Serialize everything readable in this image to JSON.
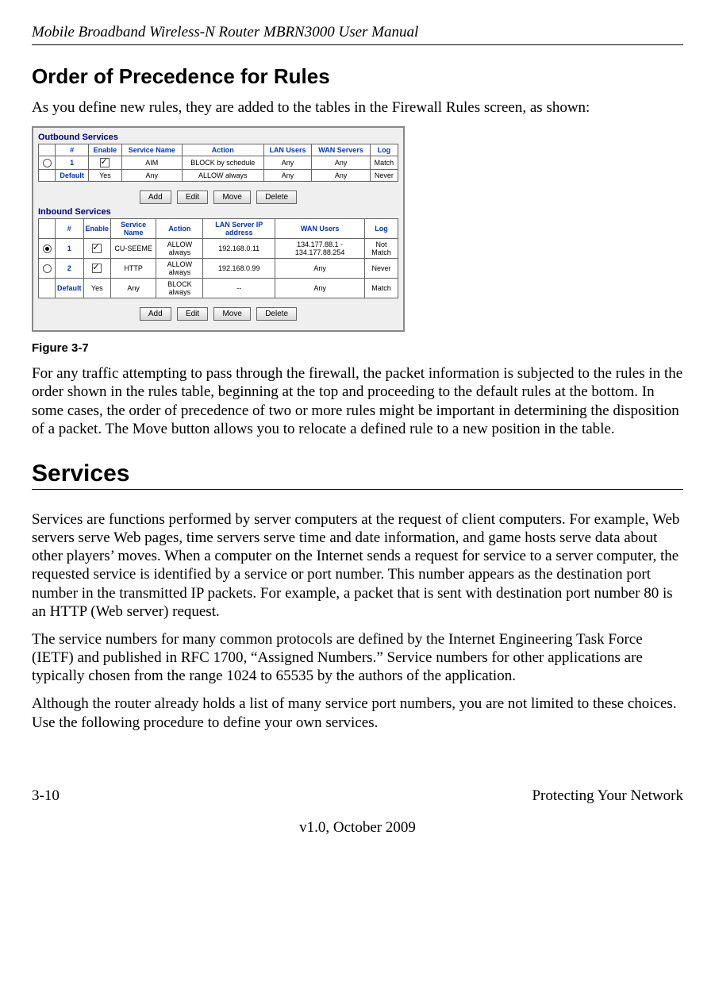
{
  "header": {
    "title": "Mobile Broadband Wireless-N Router MBRN3000 User Manual"
  },
  "subheading1": "Order of Precedence for Rules",
  "p1": "As you define new rules, they are added to the tables in the Firewall Rules screen, as shown:",
  "figure": {
    "outbound_label": "Outbound Services",
    "inbound_label": "Inbound Services",
    "out_headers": {
      "num": "#",
      "enable": "Enable",
      "service": "Service Name",
      "action": "Action",
      "lan": "LAN Users",
      "wan": "WAN Servers",
      "log": "Log"
    },
    "out_rows": [
      {
        "sel": false,
        "num": "1",
        "enable": true,
        "service": "AIM",
        "action": "BLOCK by schedule",
        "lan": "Any",
        "wan": "Any",
        "log": "Match"
      },
      {
        "num": "Default",
        "enable_txt": "Yes",
        "service": "Any",
        "action": "ALLOW always",
        "lan": "Any",
        "wan": "Any",
        "log": "Never"
      }
    ],
    "in_headers": {
      "num": "#",
      "enable": "Enable",
      "service": "Service Name",
      "action": "Action",
      "lanip": "LAN Server IP address",
      "wan": "WAN Users",
      "log": "Log"
    },
    "in_rows": [
      {
        "sel": true,
        "num": "1",
        "enable": true,
        "service": "CU-SEEME",
        "action": "ALLOW always",
        "lanip": "192.168.0.11",
        "wan": "134.177.88.1 - 134.177.88.254",
        "log": "Not Match"
      },
      {
        "sel": false,
        "num": "2",
        "enable": true,
        "service": "HTTP",
        "action": "ALLOW always",
        "lanip": "192.168.0.99",
        "wan": "Any",
        "log": "Never"
      },
      {
        "num": "Default",
        "enable_txt": "Yes",
        "service": "Any",
        "action": "BLOCK always",
        "lanip": "--",
        "wan": "Any",
        "log": "Match"
      }
    ],
    "buttons": {
      "add": "Add",
      "edit": "Edit",
      "move": "Move",
      "delete": "Delete"
    },
    "caption": "Figure 3-7"
  },
  "p2": "For any traffic attempting to pass through the firewall, the packet information is subjected to the rules in the order shown in the rules table, beginning at the top and proceeding to the default rules at the bottom. In some cases, the order of precedence of two or more rules might be important in determining the disposition of a packet. The Move button allows you to relocate a defined rule to a new position in the table.",
  "section2": "Services",
  "p3": "Services are functions performed by server computers at the request of client computers. For example, Web servers serve Web pages, time servers serve time and date information, and game hosts serve data about other players’ moves. When a computer on the Internet sends a request for service to a server computer, the requested service is identified by a service or port number. This number appears as the destination port number in the transmitted IP packets. For example, a packet that is sent with destination port number 80 is an HTTP (Web server) request.",
  "p4": "The service numbers for many common protocols are defined by the Internet Engineering Task Force (IETF) and published in RFC 1700, “Assigned Numbers.” Service numbers for other applications are typically chosen from the range 1024 to 65535 by the authors of the application.",
  "p5": "Although the router already holds a list of many service port numbers, you are not limited to these choices. Use the following procedure to define your own services.",
  "footer": {
    "left": "3-10",
    "right": "Protecting Your Network",
    "center": "v1.0, October 2009"
  }
}
